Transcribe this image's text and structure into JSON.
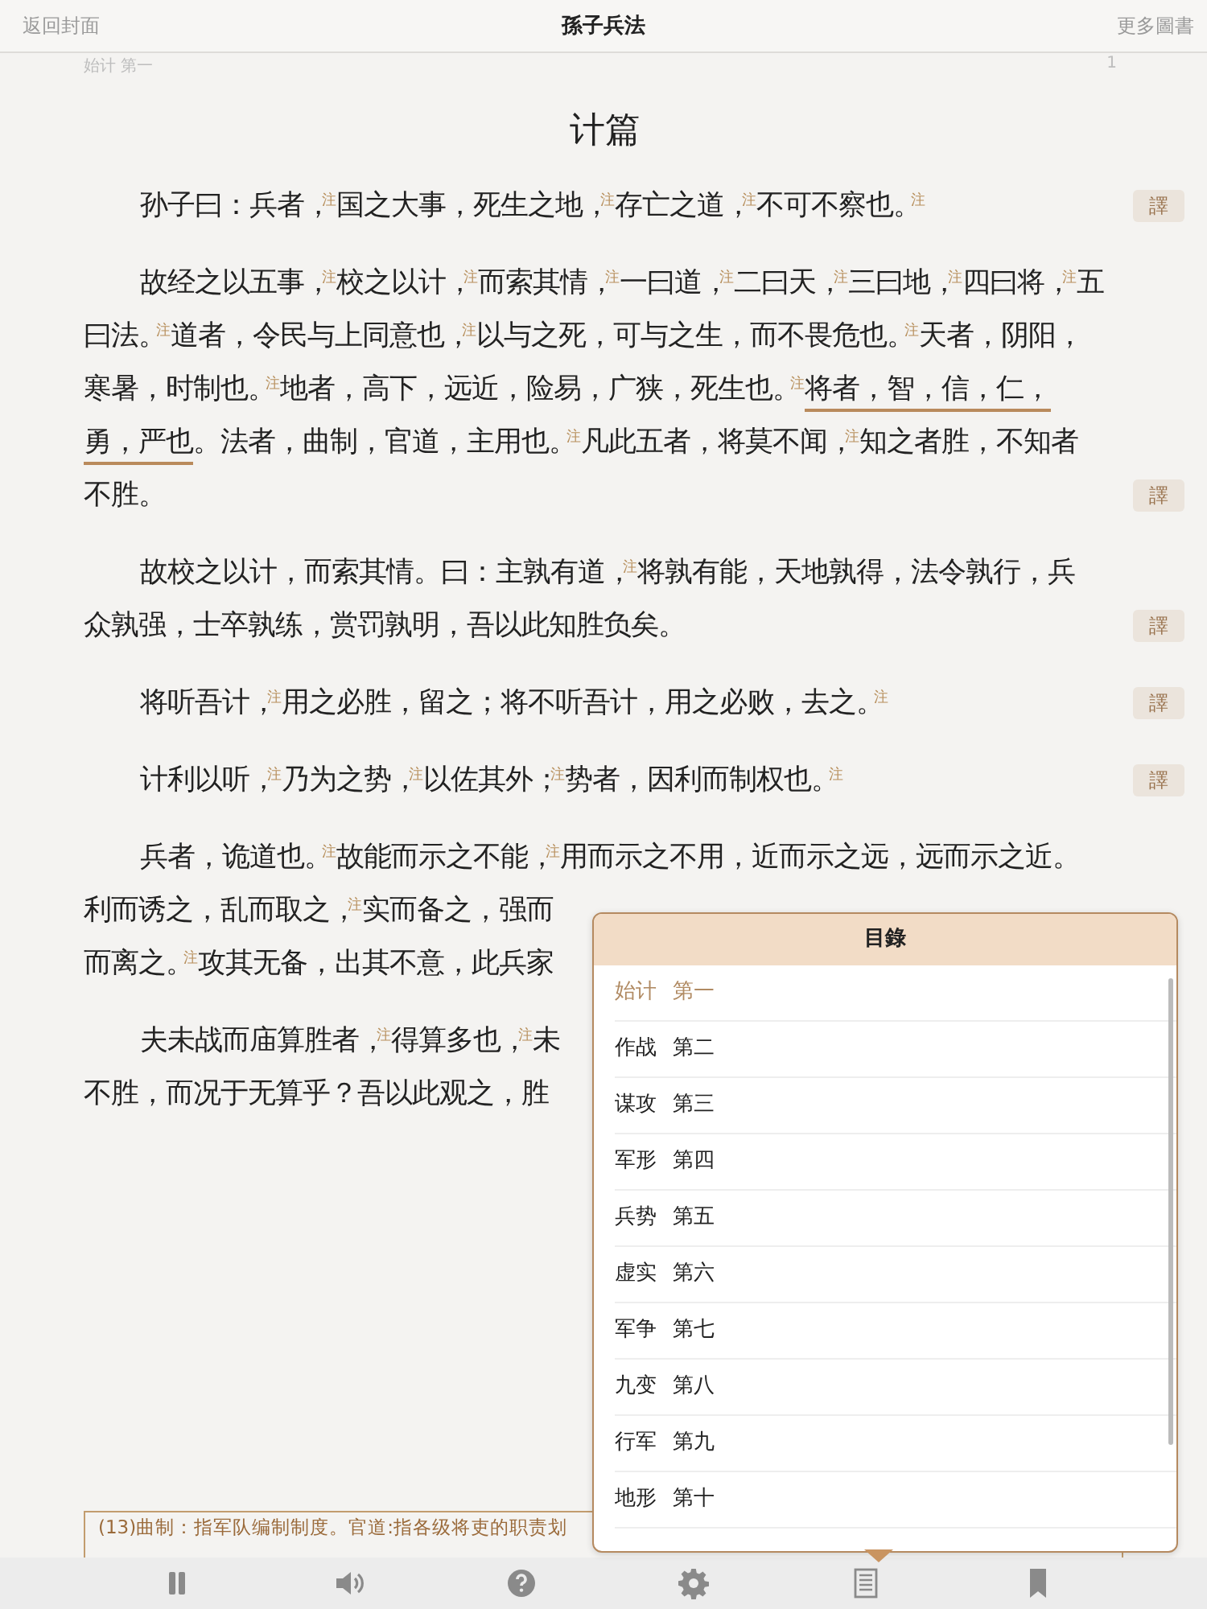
{
  "header": {
    "back": "返回封面",
    "title": "孫子兵法",
    "more": "更多圖書"
  },
  "running_head": {
    "chapter": "始计 第一",
    "page": "1"
  },
  "chapter_title": "计篇",
  "paragraphs": [
    {
      "lines": [
        "孙子曰：兵者，$^{注}$国之大事，死生之地，$^{注}$存亡之道，$^{注}$不可不察也。$^{注}$"
      ],
      "translate": "譯"
    },
    {
      "lines": [
        "故经之以五事，$^{注}$校之以计，$^{注}$而索其情，$^{注}$一曰道，$^{注}$二曰天，$^{注}$三曰地，$^{注}$四曰将，$^{注}$五",
        "曰法。$^{注}$道者，令民与上同意也，$^{注}$以与之死，可与之生，而不畏危也。$^{注}$天者，阴阳，",
        [
          {
            "text": "寒暑，时制也。$^{注}$地者，高下，远近，险易，广狭，死生也。$^{注}$",
            "underlined": false
          },
          {
            "text": "将者，智，信，仁，",
            "underlined": true
          }
        ],
        [
          {
            "text": "勇，严也",
            "underlined": true
          },
          {
            "text": "。法者，曲制，官道，主用也。$^{注}$凡此五者，将莫不闻，$^{注}$知之者胜，不知者",
            "underlined": false
          }
        ],
        "不胜。"
      ],
      "translate": "譯"
    },
    {
      "lines": [
        "故校之以计，而索其情。曰：主孰有道，$^{注}$将孰有能，天地孰得，法令孰行，兵",
        "众孰强，士卒孰练，赏罚孰明，吾以此知胜负矣。"
      ],
      "translate": "譯"
    },
    {
      "lines": [
        "将听吾计，$^{注}$用之必胜，留之；将不听吾计，用之必败，去之。$^{注}$"
      ],
      "translate": "譯"
    },
    {
      "lines": [
        "计利以听，$^{注}$乃为之势，$^{注}$以佐其外；$^{注}$势者，因利而制权也。$^{注}$"
      ],
      "translate": "譯"
    },
    {
      "lines": [
        "兵者，诡道也。$^{注}$故能而示之不能，$^{注}$用而示之不用，近而示之远，远而示之近。",
        "利而诱之，乱而取之，$^{注}$实而备之，强而",
        "而离之。$^{注}$攻其无备，出其不意，此兵家"
      ]
    },
    {
      "lines": [
        "夫未战而庙算胜者，$^{注}$得算多也，$^{注}$未",
        "不胜，而况于无算乎？吾以此观之，胜"
      ]
    }
  ],
  "footnote": "(13)曲制：指军队编制制度。官道:指各级将吏的职责划",
  "toc_popover": {
    "title": "目錄",
    "items": [
      {
        "label": "始计 第一",
        "selected": true
      },
      {
        "label": "作战 第二",
        "selected": false
      },
      {
        "label": "谋攻 第三",
        "selected": false
      },
      {
        "label": "军形 第四",
        "selected": false
      },
      {
        "label": "兵势 第五",
        "selected": false
      },
      {
        "label": "虚实 第六",
        "selected": false
      },
      {
        "label": "军争 第七",
        "selected": false
      },
      {
        "label": "九变 第八",
        "selected": false
      },
      {
        "label": "行军 第九",
        "selected": false
      },
      {
        "label": "地形 第十",
        "selected": false
      }
    ]
  },
  "toolbar": [
    {
      "kind": "pause"
    },
    {
      "kind": "speaker"
    },
    {
      "kind": "help"
    },
    {
      "kind": "settings"
    },
    {
      "kind": "contents"
    },
    {
      "kind": "bookmark"
    }
  ]
}
